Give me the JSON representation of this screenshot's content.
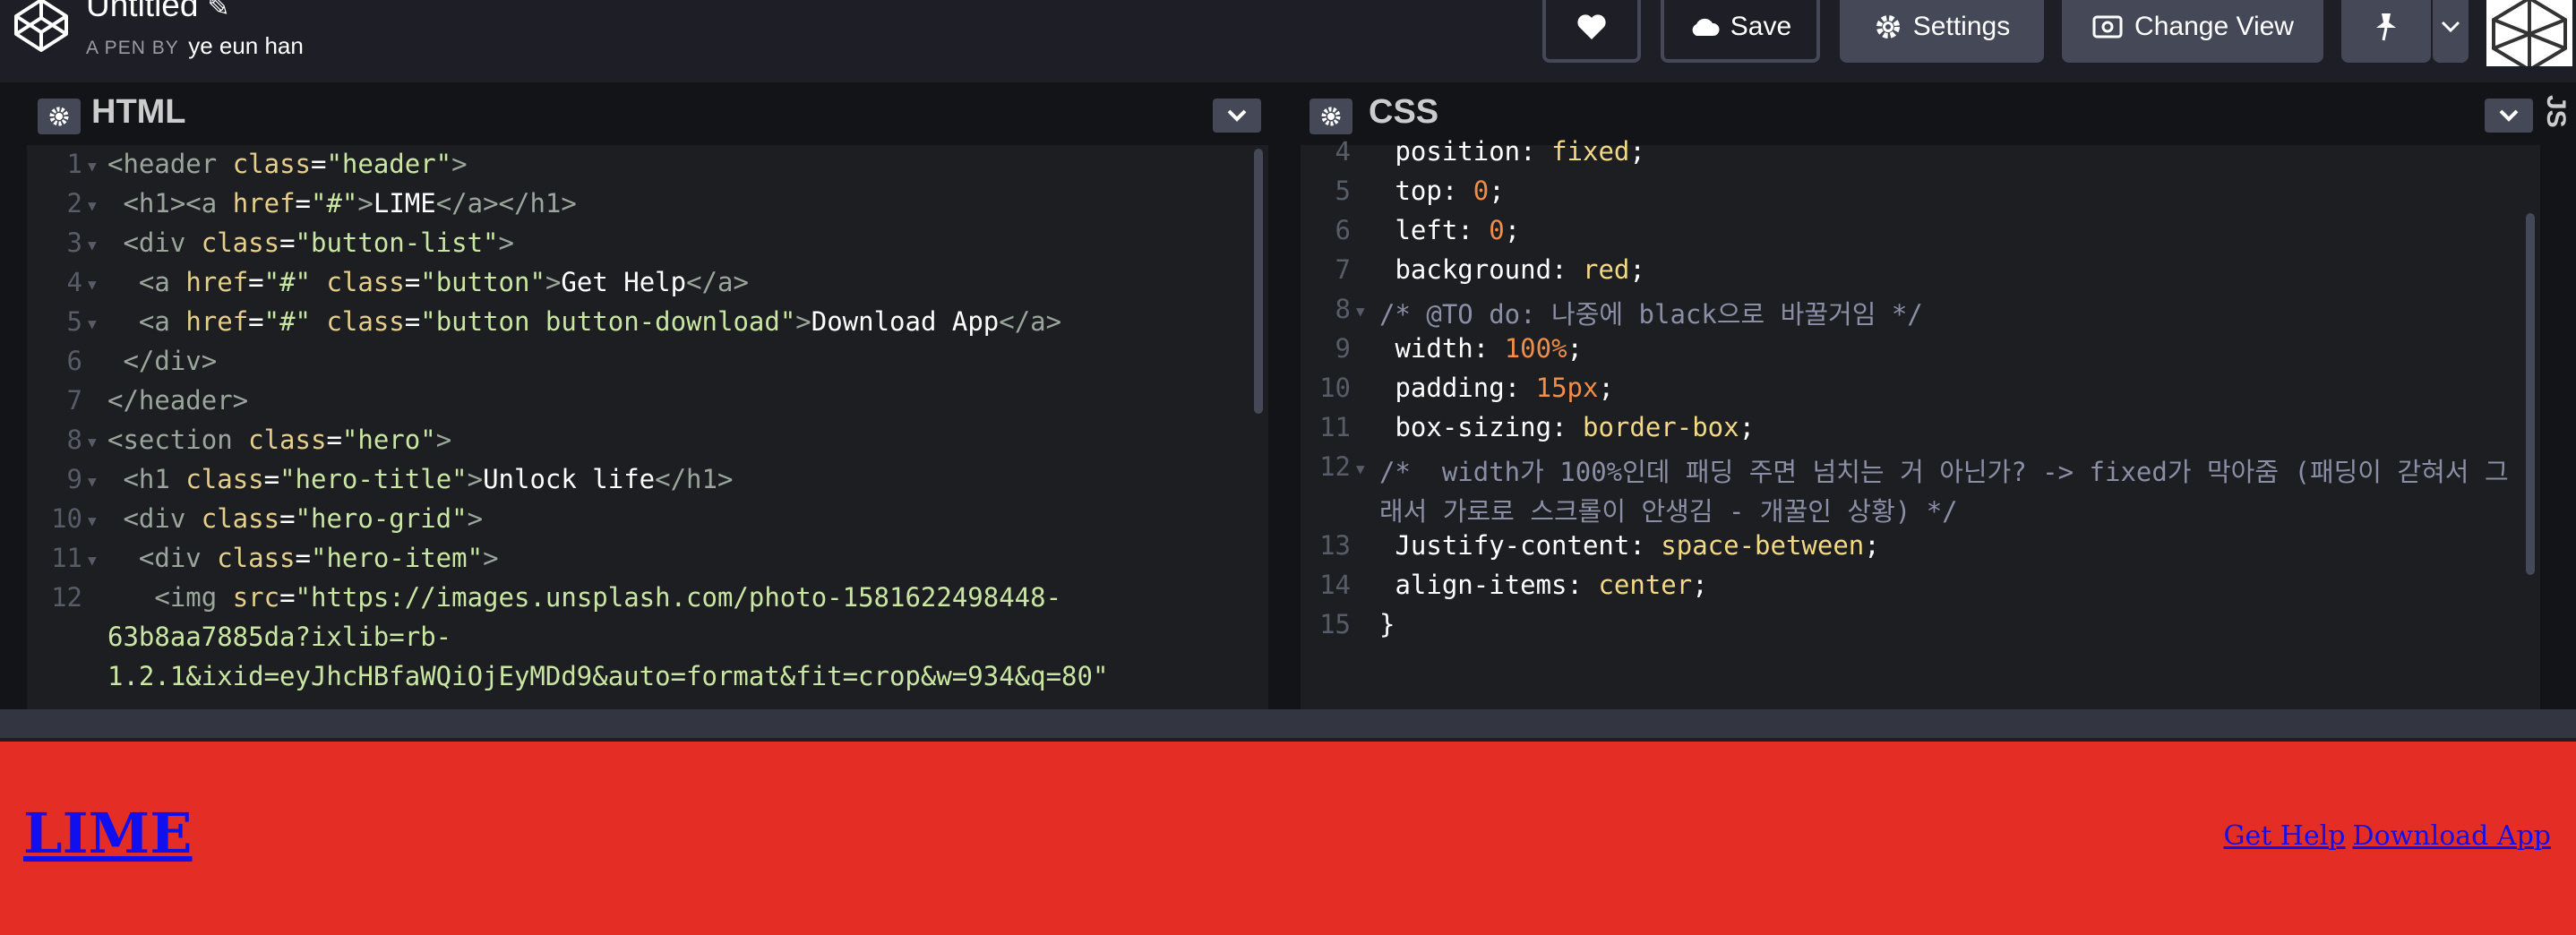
{
  "header": {
    "title": "Untitled",
    "pen_by_label": "A PEN BY",
    "author": "ye eun han",
    "buttons": {
      "save": "Save",
      "settings": "Settings",
      "change_view": "Change View"
    }
  },
  "html_editor": {
    "title": "HTML",
    "lines": [
      {
        "n": "1",
        "fold": true,
        "parts": [
          [
            "tag",
            "<header "
          ],
          [
            "attr",
            "class"
          ],
          [
            "plain",
            "="
          ],
          [
            "str",
            "\"header\""
          ],
          [
            "tag",
            ">"
          ]
        ]
      },
      {
        "n": "2",
        "fold": true,
        "parts": [
          [
            "tag",
            " <h1><a "
          ],
          [
            "attr",
            "href"
          ],
          [
            "plain",
            "="
          ],
          [
            "str",
            "\"#\""
          ],
          [
            "tag",
            ">"
          ],
          [
            "plain",
            "LIME"
          ],
          [
            "tag",
            "</a></h1>"
          ]
        ]
      },
      {
        "n": "3",
        "fold": true,
        "parts": [
          [
            "tag",
            " <div "
          ],
          [
            "attr",
            "class"
          ],
          [
            "plain",
            "="
          ],
          [
            "str",
            "\"button-list\""
          ],
          [
            "tag",
            ">"
          ]
        ]
      },
      {
        "n": "4",
        "fold": true,
        "parts": [
          [
            "tag",
            "  <a "
          ],
          [
            "attr",
            "href"
          ],
          [
            "plain",
            "="
          ],
          [
            "str",
            "\"#\" "
          ],
          [
            "attr",
            "class"
          ],
          [
            "plain",
            "="
          ],
          [
            "str",
            "\"button\""
          ],
          [
            "tag",
            ">"
          ],
          [
            "plain",
            "Get Help"
          ],
          [
            "tag",
            "</a>"
          ]
        ]
      },
      {
        "n": "5",
        "fold": true,
        "parts": [
          [
            "tag",
            "  <a "
          ],
          [
            "attr",
            "href"
          ],
          [
            "plain",
            "="
          ],
          [
            "str",
            "\"#\" "
          ],
          [
            "attr",
            "class"
          ],
          [
            "plain",
            "="
          ],
          [
            "str",
            "\"button button-download\""
          ],
          [
            "tag",
            ">"
          ],
          [
            "plain",
            "Download App"
          ],
          [
            "tag",
            "</a>"
          ]
        ]
      },
      {
        "n": "6",
        "fold": false,
        "parts": [
          [
            "tag",
            " </div>"
          ]
        ]
      },
      {
        "n": "7",
        "fold": false,
        "parts": [
          [
            "tag",
            "</header>"
          ]
        ]
      },
      {
        "n": "8",
        "fold": true,
        "parts": [
          [
            "tag",
            "<section "
          ],
          [
            "attr",
            "class"
          ],
          [
            "plain",
            "="
          ],
          [
            "str",
            "\"hero\""
          ],
          [
            "tag",
            ">"
          ]
        ]
      },
      {
        "n": "9",
        "fold": true,
        "parts": [
          [
            "tag",
            " <h1 "
          ],
          [
            "attr",
            "class"
          ],
          [
            "plain",
            "="
          ],
          [
            "str",
            "\"hero-title\""
          ],
          [
            "tag",
            ">"
          ],
          [
            "plain",
            "Unlock life"
          ],
          [
            "tag",
            "</h1>"
          ]
        ]
      },
      {
        "n": "10",
        "fold": true,
        "parts": [
          [
            "tag",
            " <div "
          ],
          [
            "attr",
            "class"
          ],
          [
            "plain",
            "="
          ],
          [
            "str",
            "\"hero-grid\""
          ],
          [
            "tag",
            ">"
          ]
        ]
      },
      {
        "n": "11",
        "fold": true,
        "parts": [
          [
            "tag",
            "  <div "
          ],
          [
            "attr",
            "class"
          ],
          [
            "plain",
            "="
          ],
          [
            "str",
            "\"hero-item\""
          ],
          [
            "tag",
            ">"
          ]
        ]
      },
      {
        "n": "12",
        "fold": false,
        "parts": [
          [
            "tag",
            "   <img "
          ],
          [
            "attr",
            "src"
          ],
          [
            "plain",
            "="
          ],
          [
            "str",
            "\"https://images.unsplash.com/photo-1581622498448-"
          ]
        ]
      },
      {
        "n": "",
        "fold": false,
        "parts": [
          [
            "str",
            "63b8aa7885da?ixlib=rb-"
          ]
        ]
      },
      {
        "n": "",
        "fold": false,
        "parts": [
          [
            "str",
            "1.2.1&ixid=eyJhcHBfaWQiOjEyMDd9&auto=format&fit=crop&w=934&q=80\""
          ]
        ]
      }
    ]
  },
  "css_editor": {
    "title": "CSS",
    "lines": [
      {
        "n": "4",
        "fold": false,
        "parts": [
          [
            "prop",
            " position"
          ],
          [
            "plain",
            ": "
          ],
          [
            "val",
            "fixed"
          ],
          [
            "plain",
            ";"
          ]
        ]
      },
      {
        "n": "5",
        "fold": false,
        "parts": [
          [
            "prop",
            " top"
          ],
          [
            "plain",
            ": "
          ],
          [
            "num",
            "0"
          ],
          [
            "plain",
            ";"
          ]
        ]
      },
      {
        "n": "6",
        "fold": false,
        "parts": [
          [
            "prop",
            " left"
          ],
          [
            "plain",
            ": "
          ],
          [
            "num",
            "0"
          ],
          [
            "plain",
            ";"
          ]
        ]
      },
      {
        "n": "7",
        "fold": false,
        "parts": [
          [
            "prop",
            " background"
          ],
          [
            "plain",
            ": "
          ],
          [
            "val",
            "red"
          ],
          [
            "plain",
            ";"
          ]
        ]
      },
      {
        "n": "8",
        "fold": true,
        "parts": [
          [
            "cmt",
            "/* @TO do: 나중에 black으로 바꿀거임 */"
          ]
        ]
      },
      {
        "n": "9",
        "fold": false,
        "parts": [
          [
            "prop",
            " width"
          ],
          [
            "plain",
            ": "
          ],
          [
            "num",
            "100%"
          ],
          [
            "plain",
            ";"
          ]
        ]
      },
      {
        "n": "10",
        "fold": false,
        "parts": [
          [
            "prop",
            " padding"
          ],
          [
            "plain",
            ": "
          ],
          [
            "num",
            "15px"
          ],
          [
            "plain",
            ";"
          ]
        ]
      },
      {
        "n": "11",
        "fold": false,
        "parts": [
          [
            "prop",
            " box-sizing"
          ],
          [
            "plain",
            ": "
          ],
          [
            "val",
            "border-box"
          ],
          [
            "plain",
            ";"
          ]
        ]
      },
      {
        "n": "12",
        "fold": true,
        "parts": [
          [
            "cmt",
            "/*  width가 100%인데 패딩 주면 넘치는 거 아닌가? -> fixed가 막아줌 (패딩이 갇혀서 그"
          ]
        ]
      },
      {
        "n": "",
        "fold": false,
        "parts": [
          [
            "cmt",
            "래서 가로로 스크롤이 안생김 - 개꿀인 상황) */"
          ]
        ]
      },
      {
        "n": "13",
        "fold": false,
        "parts": [
          [
            "prop",
            " Justify-content"
          ],
          [
            "plain",
            ": "
          ],
          [
            "val",
            "space-between"
          ],
          [
            "plain",
            ";"
          ]
        ]
      },
      {
        "n": "14",
        "fold": false,
        "parts": [
          [
            "prop",
            " align-items"
          ],
          [
            "plain",
            ": "
          ],
          [
            "val",
            "center"
          ],
          [
            "plain",
            ";"
          ]
        ]
      },
      {
        "n": "15",
        "fold": false,
        "parts": [
          [
            "plain",
            "}"
          ]
        ]
      }
    ]
  },
  "js_rail_label": "JS",
  "preview": {
    "brand": "LIME",
    "links": [
      "Get Help",
      "Download App"
    ]
  },
  "colors": {
    "preview_bg": "#e42d24",
    "link": "#1010ee"
  }
}
